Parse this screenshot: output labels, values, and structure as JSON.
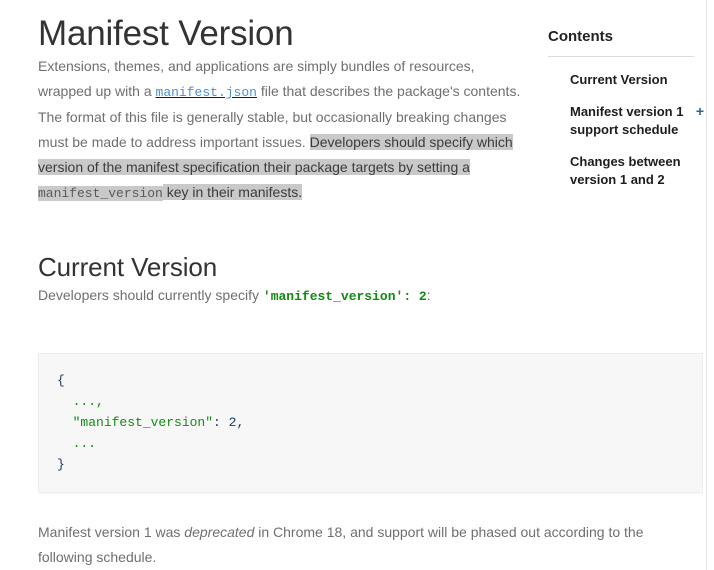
{
  "page": {
    "title": "Manifest Version"
  },
  "intro": {
    "part1": "Extensions, themes, and applications are simply bundles of resources, wrapped up with a ",
    "code_link": "manifest.json",
    "part2": " file that describes the package's contents. The format of this file is generally stable, but occasionally breaking changes must be made to address important issues. ",
    "selected_part1": "Developers should specify which version of the manifest specification their package targets by setting a ",
    "selected_code": "manifest_version",
    "selected_part2": " key in their manifests."
  },
  "current_version": {
    "heading": "Current Version",
    "para_prefix": "Developers should currently specify ",
    "para_code": "'manifest_version': 2",
    "para_suffix": ":",
    "code_sample": {
      "line_open": "{",
      "line_ellipsis_comma": "...,",
      "key": "\"manifest_version\"",
      "colon": ": ",
      "value": "2",
      "comma": ",",
      "line_ellipsis": "...",
      "line_close": "}"
    }
  },
  "closing": {
    "prefix": "Manifest version 1 was ",
    "emphasis": "deprecated",
    "suffix": " in Chrome 18, and support will be phased out according to the following schedule."
  },
  "toc": {
    "title": "Contents",
    "items": [
      {
        "label": "Current Version",
        "expand": null
      },
      {
        "label": "Manifest version 1 support schedule",
        "expand": "+"
      },
      {
        "label": "Changes between version 1 and 2",
        "expand": null
      }
    ]
  },
  "colors": {
    "link_blue": "#4d90cf",
    "code_green": "#128a12",
    "selection_gray": "#c9c9c9",
    "heading_dark": "#333333",
    "body_gray": "#6f6f6f",
    "codeblock_bg": "#f7f7f7"
  }
}
